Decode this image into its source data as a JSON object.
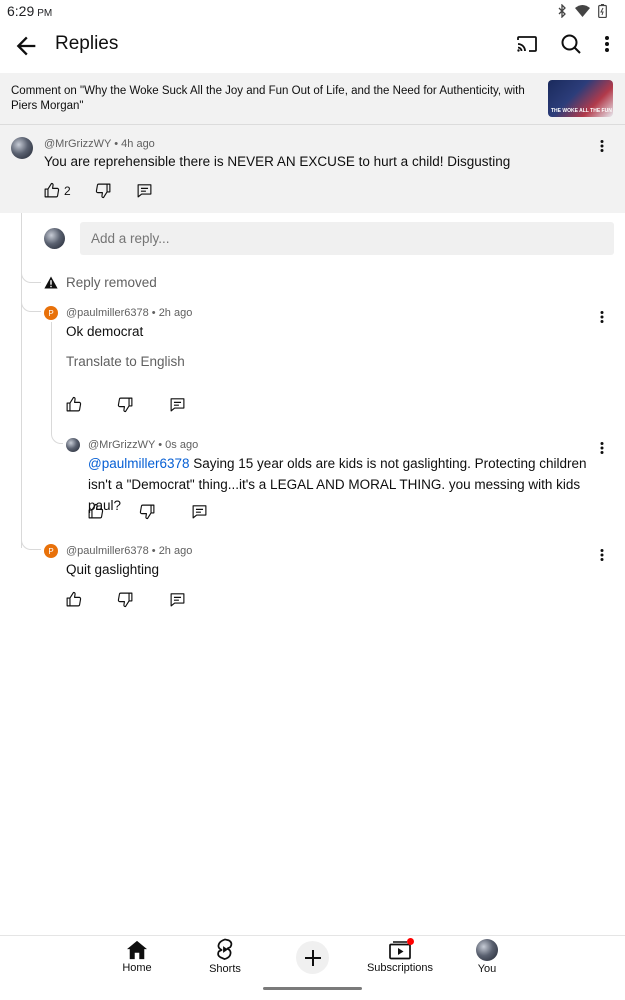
{
  "status": {
    "time": "6:29",
    "ampm": "PM"
  },
  "app_bar": {
    "title": "Replies"
  },
  "video": {
    "ref_text": "Comment on \"Why the Woke Suck All the Joy and Fun Out of Life, and the Need for Authenticity, with Piers Morgan\"",
    "thumb_label": "THE WOKE ALL THE FUN"
  },
  "main_comment": {
    "author": "@MrGrizzWY",
    "time": "4h ago",
    "text": "You are reprehensible there is NEVER AN EXCUSE to hurt a child! Disgusting",
    "likes": "2"
  },
  "reply_input": {
    "placeholder": "Add a reply..."
  },
  "removed": {
    "text": "Reply removed"
  },
  "replies": [
    {
      "avatar_letter": "P",
      "author": "@paulmiller6378",
      "time": "2h ago",
      "text": "Ok democrat",
      "translate": "Translate to English"
    },
    {
      "author": "@MrGrizzWY",
      "time": "0s ago",
      "mention": "@paulmiller6378",
      "text": " Saying 15 year olds are kids is not gaslighting. Protecting children isn't a \"Democrat\" thing...it's a LEGAL AND MORAL THING. you messing with kids paul?"
    },
    {
      "avatar_letter": "P",
      "author": "@paulmiller6378",
      "time": "2h ago",
      "text": "Quit gaslighting"
    }
  ],
  "nav": {
    "home": "Home",
    "shorts": "Shorts",
    "subscriptions": "Subscriptions",
    "you": "You"
  },
  "meta_separator": " • ",
  "colors": {
    "accent_link": "#065fd4",
    "brand_red": "#ff0000",
    "avatar_orange": "#e8710a"
  }
}
